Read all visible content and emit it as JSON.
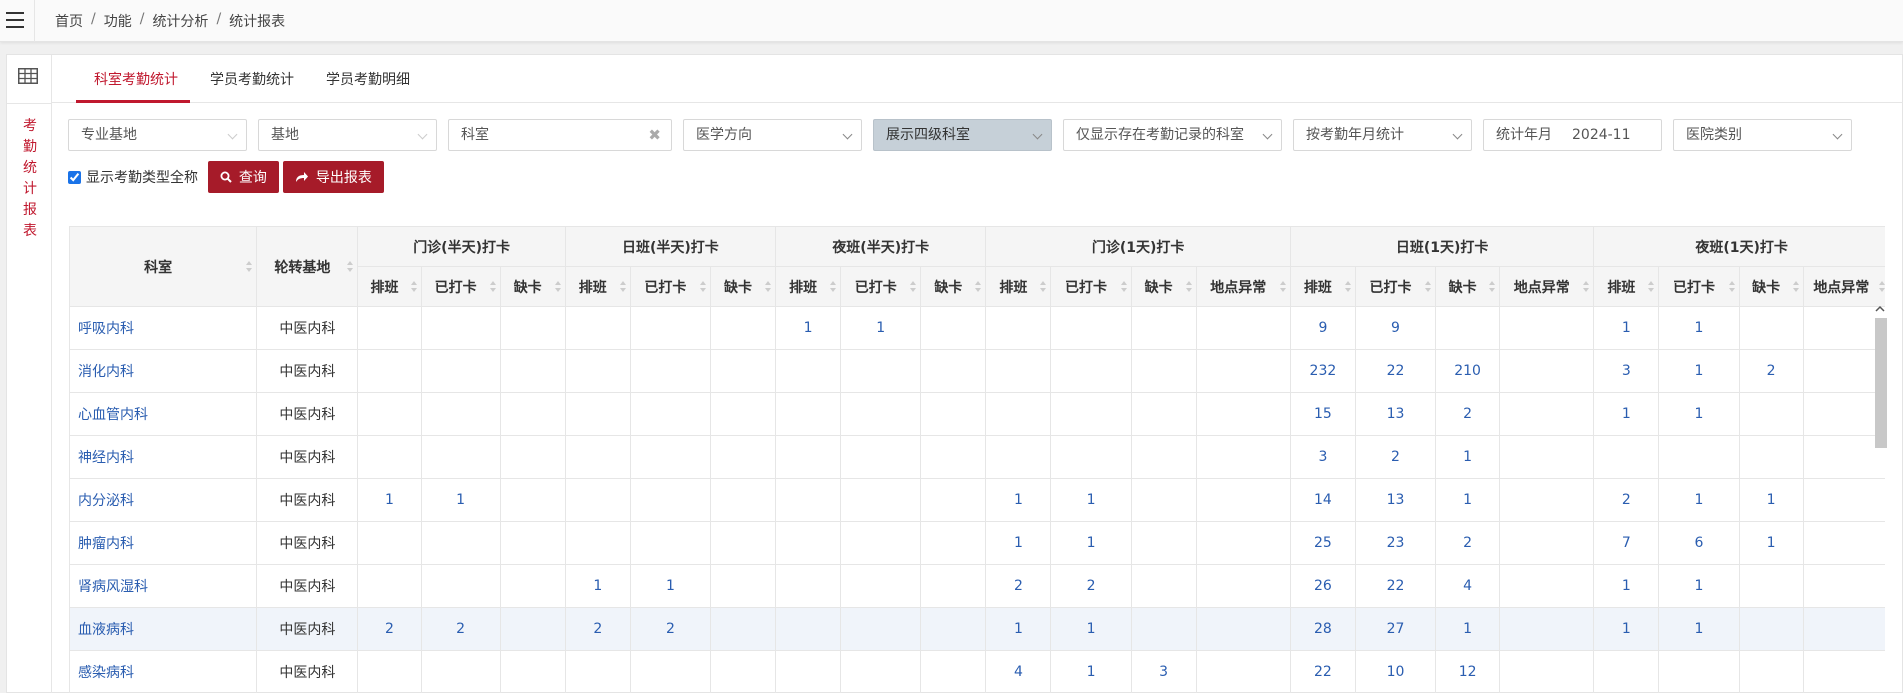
{
  "breadcrumb": [
    "首页",
    "功能",
    "统计分析",
    "统计报表"
  ],
  "vertical_title": [
    "考",
    "勤",
    "统",
    "计",
    "报",
    "表"
  ],
  "tabs": [
    "科室考勤统计",
    "学员考勤统计",
    "学员考勤明细"
  ],
  "filters": {
    "professional_base": "专业基地",
    "base": "基地",
    "department": "科室",
    "medical_direction": "医学方向",
    "dept_level": "展示四级科室",
    "attendance_filter": "仅显示存在考勤记录的科室",
    "stat_mode": "按考勤年月统计",
    "year_month_label": "统计年月",
    "year_month_value": "2024-11",
    "hospital_type": "医院类别"
  },
  "show_fullname_label": "显示考勤类型全称",
  "show_fullname_checked": true,
  "buttons": {
    "query": "查询",
    "export": "导出报表"
  },
  "table": {
    "col_dept": "科室",
    "col_base": "轮转基地",
    "groups": [
      "门诊(半天)打卡",
      "日班(半天)打卡",
      "夜班(半天)打卡",
      "门诊(1天)打卡",
      "日班(1天)打卡",
      "夜班(1天)打卡"
    ],
    "sub3": [
      "排班",
      "已打卡",
      "缺卡"
    ],
    "sub4": [
      "排班",
      "已打卡",
      "缺卡",
      "地点异常"
    ],
    "rows": [
      {
        "dept": "呼吸内科",
        "base": "中医内科",
        "cells": [
          "",
          "",
          "",
          "",
          "",
          "",
          "1",
          "1",
          "",
          "",
          "",
          "",
          "",
          "9",
          "9",
          "",
          "",
          "1",
          "1",
          "",
          ""
        ]
      },
      {
        "dept": "消化内科",
        "base": "中医内科",
        "cells": [
          "",
          "",
          "",
          "",
          "",
          "",
          "",
          "",
          "",
          "",
          "",
          "",
          "",
          "232",
          "22",
          "210",
          "",
          "3",
          "1",
          "2",
          ""
        ]
      },
      {
        "dept": "心血管内科",
        "base": "中医内科",
        "cells": [
          "",
          "",
          "",
          "",
          "",
          "",
          "",
          "",
          "",
          "",
          "",
          "",
          "",
          "15",
          "13",
          "2",
          "",
          "1",
          "1",
          "",
          ""
        ]
      },
      {
        "dept": "神经内科",
        "base": "中医内科",
        "cells": [
          "",
          "",
          "",
          "",
          "",
          "",
          "",
          "",
          "",
          "",
          "",
          "",
          "",
          "3",
          "2",
          "1",
          "",
          "",
          "",
          "",
          ""
        ]
      },
      {
        "dept": "内分泌科",
        "base": "中医内科",
        "cells": [
          "1",
          "1",
          "",
          "",
          "",
          "",
          "",
          "",
          "",
          "1",
          "1",
          "",
          "",
          "14",
          "13",
          "1",
          "",
          "2",
          "1",
          "1",
          ""
        ]
      },
      {
        "dept": "肿瘤内科",
        "base": "中医内科",
        "cells": [
          "",
          "",
          "",
          "",
          "",
          "",
          "",
          "",
          "",
          "1",
          "1",
          "",
          "",
          "25",
          "23",
          "2",
          "",
          "7",
          "6",
          "1",
          ""
        ]
      },
      {
        "dept": "肾病风湿科",
        "base": "中医内科",
        "cells": [
          "",
          "",
          "",
          "1",
          "1",
          "",
          "",
          "",
          "",
          "2",
          "2",
          "",
          "",
          "26",
          "22",
          "4",
          "",
          "1",
          "1",
          "",
          ""
        ]
      },
      {
        "dept": "血液病科",
        "base": "中医内科",
        "cells": [
          "2",
          "2",
          "",
          "2",
          "2",
          "",
          "",
          "",
          "",
          "1",
          "1",
          "",
          "",
          "28",
          "27",
          "1",
          "",
          "1",
          "1",
          "",
          ""
        ]
      },
      {
        "dept": "感染病科",
        "base": "中医内科",
        "cells": [
          "",
          "",
          "",
          "",
          "",
          "",
          "",
          "",
          "",
          "4",
          "1",
          "3",
          "",
          "22",
          "10",
          "12",
          "",
          "",
          "",
          "",
          ""
        ]
      }
    ]
  }
}
